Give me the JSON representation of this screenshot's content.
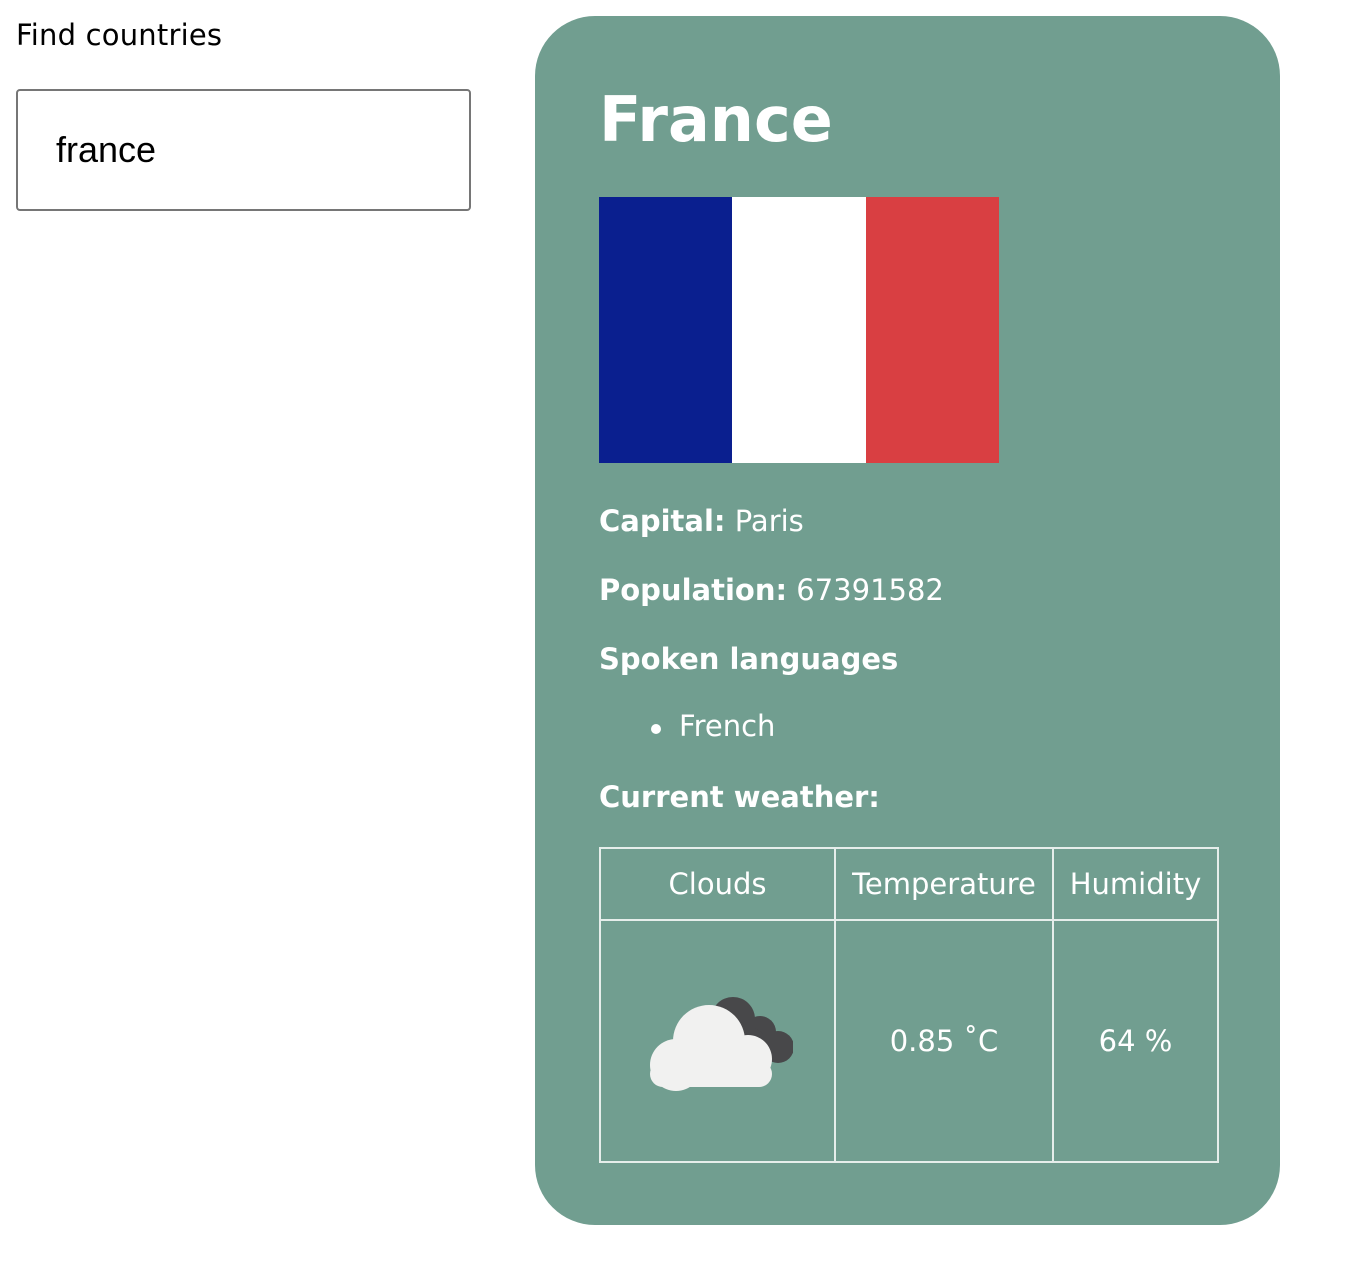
{
  "search": {
    "label": "Find countries",
    "value": "france"
  },
  "country": {
    "name": "France",
    "flag": {
      "colors": [
        "#0a1f8f",
        "#ffffff",
        "#d93f42"
      ]
    },
    "capital_label": "Capital:",
    "capital": "Paris",
    "population_label": "Population:",
    "population": "67391582",
    "languages_heading": "Spoken languages",
    "languages": [
      "French"
    ],
    "weather_heading": "Current weather:"
  },
  "weather": {
    "headers": [
      "Clouds",
      "Temperature",
      "Humidity"
    ],
    "icon": "clouds-icon",
    "temperature": "0.85 ˚C",
    "humidity": "64 %"
  },
  "colors": {
    "card_background": "#719e90",
    "card_text": "#ffffff"
  }
}
